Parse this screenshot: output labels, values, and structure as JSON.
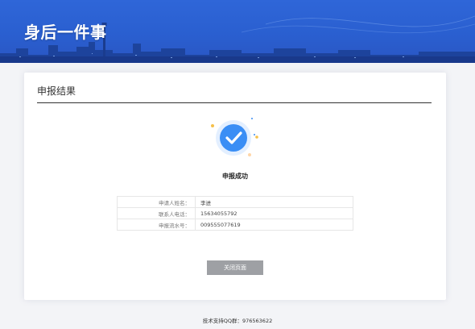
{
  "banner": {
    "title": "身后一件事"
  },
  "card": {
    "heading": "申报结果",
    "status_text": "申报成功",
    "info_rows": [
      {
        "label": "申请人姓名：",
        "value": "李进"
      },
      {
        "label": "联系人电话：",
        "value": "15634055792"
      },
      {
        "label": "申报流水号：",
        "value": "009555077619"
      }
    ],
    "close_label": "关闭页面"
  },
  "footer": {
    "text": "技术支持QQ群：976563622"
  },
  "colors": {
    "accent": "#3a8ef5",
    "banner": "#2f66d8",
    "button": "#9ea0a4"
  }
}
